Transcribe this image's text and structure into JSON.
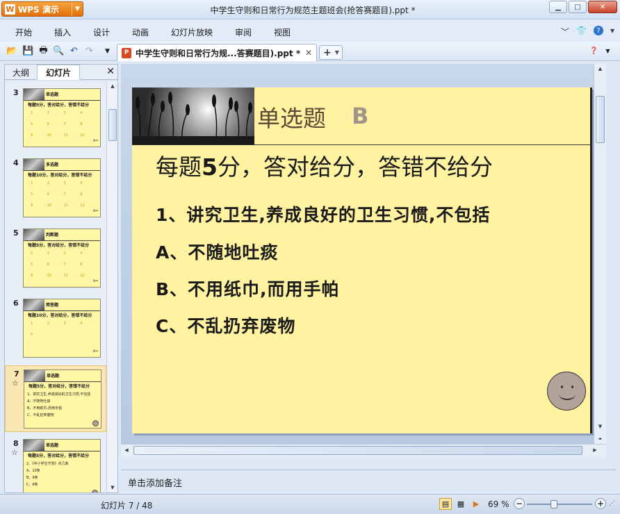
{
  "app": {
    "button_label": "WPS 演示",
    "window_title": "中学生守则和日常行为规范主题班会(抢答赛题目).ppt *"
  },
  "menu": [
    "开始",
    "插入",
    "设计",
    "动画",
    "幻灯片放映",
    "审阅",
    "视图"
  ],
  "document_tab": {
    "label": "中学生守则和日常行为规...答赛题目).ppt *"
  },
  "left_panel": {
    "tabs": [
      "大纲",
      "幻灯片"
    ],
    "active_tab": "幻灯片",
    "thumbnails": [
      {
        "num": "3",
        "title": "单选题",
        "text": "每题5分，答对给分，答错不给分",
        "grid": [
          "1",
          "2",
          "3",
          "4",
          "5",
          "6",
          "7",
          "8",
          "9",
          "10",
          "11",
          "12"
        ],
        "star": false,
        "selected": false,
        "mark": "arrow"
      },
      {
        "num": "4",
        "title": "多选题",
        "text": "每题10分，答对给分，答错不给分",
        "grid": [
          "1",
          "2",
          "3",
          "4",
          "5",
          "6",
          "7",
          "8",
          "9",
          "10",
          "11",
          "12"
        ],
        "star": false,
        "selected": false,
        "mark": "arrow"
      },
      {
        "num": "5",
        "title": "判断题",
        "text": "每题5分，答对给分，答错不给分",
        "grid": [
          "1",
          "2",
          "3",
          "4",
          "5",
          "6",
          "7",
          "8",
          "9",
          "10",
          "11",
          "12"
        ],
        "star": false,
        "selected": false,
        "mark": "arrow"
      },
      {
        "num": "6",
        "title": "简答题",
        "text": "每题10分，答对给分，答错不给分",
        "grid": [
          "1",
          "2",
          "3",
          "4",
          "5"
        ],
        "star": false,
        "selected": false,
        "mark": "arrow"
      },
      {
        "num": "7",
        "title": "单选题",
        "text": "每题5分，答对给分，答错不给分",
        "lines": [
          "1、讲究卫生,养成良好的卫生习惯,不包括",
          "A、不随地吐痰",
          "B、不用纸巾,而用手帕",
          "C、不乱扔弃废物"
        ],
        "star": true,
        "selected": true,
        "mark": "smile"
      },
      {
        "num": "8",
        "title": "单选题",
        "text": "每题5分，答对给分，答错不给分",
        "lines": [
          "2、《中小学生守则》共几条",
          "A、10条",
          "B、9条",
          "C、8条"
        ],
        "star": true,
        "selected": false,
        "mark": "smile"
      }
    ]
  },
  "slide": {
    "title": "单选题",
    "title_letter": "B",
    "subtitle_pre": "每题",
    "subtitle_num": "5",
    "subtitle_post": "分，答对给分，答错不给分",
    "question": "1、讲究卫生,养成良好的卫生习惯,不包括",
    "options": [
      "A、不随地吐痰",
      "B、不用纸巾,而用手帕",
      "C、不乱扔弃废物"
    ]
  },
  "notes": {
    "placeholder": "单击添加备注"
  },
  "status": {
    "slide_counter": "幻灯片 7 / 48",
    "zoom": "69 %",
    "zoom_level": 0.42
  },
  "colors": {
    "slide_bg": "#fff2a0",
    "accent_orange": "#e2700d",
    "selected_thumb": "#fbe7b4"
  }
}
